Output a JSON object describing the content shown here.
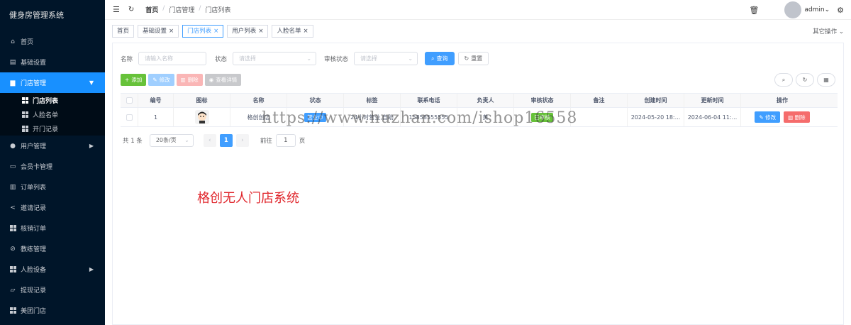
{
  "app": {
    "title": "健身房管理系统"
  },
  "sidebar": {
    "items": [
      {
        "label": "首页",
        "icon": "home-icon"
      },
      {
        "label": "基础设置",
        "icon": "settings-icon"
      },
      {
        "label": "门店管理",
        "icon": "store-icon",
        "active": true,
        "expanded": true
      },
      {
        "label": "用户管理",
        "icon": "user-icon"
      },
      {
        "label": "会员卡管理",
        "icon": "card-icon"
      },
      {
        "label": "订单列表",
        "icon": "clipboard-icon"
      },
      {
        "label": "邀请记录",
        "icon": "share-icon"
      },
      {
        "label": "核销订单",
        "icon": "grid-icon"
      },
      {
        "label": "教练管理",
        "icon": "link-icon"
      },
      {
        "label": "人脸设备",
        "icon": "grid-icon"
      },
      {
        "label": "提现记录",
        "icon": "folder-icon"
      },
      {
        "label": "美团门店",
        "icon": "grid-icon"
      }
    ],
    "submenu": [
      {
        "label": "门店列表",
        "active": true
      },
      {
        "label": "人脸名单"
      },
      {
        "label": "开门记录"
      }
    ]
  },
  "header": {
    "breadcrumb": [
      "首页",
      "门店管理",
      "门店列表"
    ],
    "user": "admin"
  },
  "tags": {
    "items": [
      {
        "label": "首页",
        "closable": false
      },
      {
        "label": "基础设置",
        "closable": true
      },
      {
        "label": "门店列表",
        "closable": true,
        "active": true
      },
      {
        "label": "用户列表",
        "closable": true
      },
      {
        "label": "人脸名单",
        "closable": true
      }
    ],
    "other_ops": "其它操作"
  },
  "search": {
    "name_label": "名称",
    "name_placeholder": "请输入名称",
    "status_label": "状态",
    "status_placeholder": "请选择",
    "audit_label": "审核状态",
    "audit_placeholder": "请选择",
    "query_btn": "查询",
    "reset_btn": "重置"
  },
  "toolbar": {
    "add": "添加",
    "edit": "修改",
    "delete": "删除",
    "view": "查看详情"
  },
  "table": {
    "headers": [
      "编号",
      "图标",
      "名称",
      "状态",
      "标签",
      "联系电话",
      "负责人",
      "审核状态",
      "备注",
      "创建时间",
      "更新时间",
      "操作"
    ],
    "rows": [
      {
        "id": "1",
        "name": "格创创店",
        "status": "营业中",
        "tags": "24小时营业,自助",
        "phone": "15858555555",
        "owner": "黄",
        "audit": "已审核",
        "remark": "",
        "created": "2024-05-20 18:...",
        "updated": "2024-06-04 11:...",
        "op_edit": "修改",
        "op_delete": "删除"
      }
    ]
  },
  "pagination": {
    "total": "共 1 条",
    "page_size": "20条/页",
    "current": "1",
    "goto_label": "前往",
    "goto_value": "1",
    "page_unit": "页"
  },
  "watermark": "https://www.huzhan.com/ishop16558",
  "promo": "格创无人门店系统",
  "colors": {
    "sidebar_bg": "#001529",
    "accent": "#1890ff",
    "primary": "#409eff",
    "success": "#67c23a",
    "danger": "#f56c6c"
  }
}
